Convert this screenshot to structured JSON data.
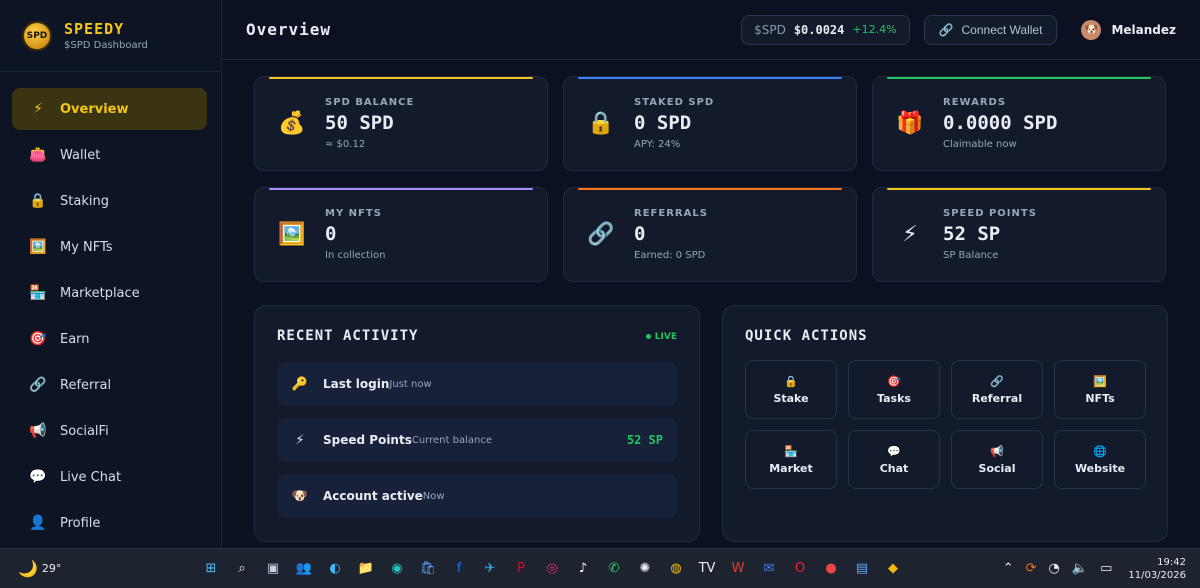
{
  "brand": {
    "logo_text": "SPD",
    "name": "SPEEDY",
    "subtitle": "$SPD Dashboard"
  },
  "sidebar": {
    "items": [
      {
        "label": "Overview",
        "icon": "⚡",
        "active": true
      },
      {
        "label": "Wallet",
        "icon": "👛"
      },
      {
        "label": "Staking",
        "icon": "🔒"
      },
      {
        "label": "My NFTs",
        "icon": "🖼️"
      },
      {
        "label": "Marketplace",
        "icon": "🏪"
      },
      {
        "label": "Earn",
        "icon": "🎯"
      },
      {
        "label": "Referral",
        "icon": "🔗"
      },
      {
        "label": "SocialFi",
        "icon": "📢"
      },
      {
        "label": "Live Chat",
        "icon": "💬"
      },
      {
        "label": "Profile",
        "icon": "👤"
      }
    ]
  },
  "header": {
    "title": "Overview",
    "price_symbol": "$SPD",
    "price_value": "$0.0024",
    "price_change": "+12.4%",
    "connect_wallet_label": "Connect Wallet",
    "connect_wallet_icon": "🔗",
    "user_name": "Melandez",
    "user_avatar_icon": "🐶"
  },
  "cards": [
    {
      "label": "SPD BALANCE",
      "value": "50 SPD",
      "sub": "≈ $0.12",
      "icon": "💰",
      "accent": "#f5c518"
    },
    {
      "label": "STAKED SPD",
      "value": "0 SPD",
      "sub": "APY: 24%",
      "icon": "🔒",
      "accent": "#3b82f6"
    },
    {
      "label": "REWARDS",
      "value": "0.0000 SPD",
      "sub": "Claimable now",
      "icon": "🎁",
      "accent": "#22c55e"
    },
    {
      "label": "MY NFTS",
      "value": "0",
      "sub": "In collection",
      "icon": "🖼️",
      "accent": "#a78bfa"
    },
    {
      "label": "REFERRALS",
      "value": "0",
      "sub": "Earned: 0 SPD",
      "icon": "🔗",
      "accent": "#f97316"
    },
    {
      "label": "SPEED POINTS",
      "value": "52 SP",
      "sub": "SP Balance",
      "icon": "⚡",
      "accent": "#f5c518"
    }
  ],
  "activity": {
    "title": "RECENT ACTIVITY",
    "live_label": "LIVE",
    "items": [
      {
        "title": "Last login",
        "time": "Just now",
        "icon": "🔑",
        "amount": ""
      },
      {
        "title": "Speed Points",
        "time": "Current balance",
        "icon": "⚡",
        "amount": "52 SP"
      },
      {
        "title": "Account active",
        "time": "Now",
        "icon": "🐶",
        "amount": ""
      }
    ]
  },
  "quick_actions": {
    "title": "QUICK ACTIONS",
    "items": [
      {
        "label": "Stake",
        "icon": "🔒"
      },
      {
        "label": "Tasks",
        "icon": "🎯"
      },
      {
        "label": "Referral",
        "icon": "🔗"
      },
      {
        "label": "NFTs",
        "icon": "🖼️"
      },
      {
        "label": "Market",
        "icon": "🏪"
      },
      {
        "label": "Chat",
        "icon": "💬"
      },
      {
        "label": "Social",
        "icon": "📢"
      },
      {
        "label": "Website",
        "icon": "🌐"
      }
    ]
  },
  "taskbar": {
    "weather_temp": "29°",
    "weather_icon": "🌙",
    "apps": [
      {
        "name": "start-icon",
        "glyph": "⊞",
        "color": "#4cc2ff"
      },
      {
        "name": "search-icon",
        "glyph": "⌕",
        "color": "#e8ecf4"
      },
      {
        "name": "task-view-icon",
        "glyph": "▣",
        "color": "#c9d1e0"
      },
      {
        "name": "teams-icon",
        "glyph": "👥",
        "color": "#7b83eb"
      },
      {
        "name": "copilot-icon",
        "glyph": "◐",
        "color": "#38bdf8"
      },
      {
        "name": "file-explorer-icon",
        "glyph": "📁",
        "color": "#f5c518"
      },
      {
        "name": "edge-icon",
        "glyph": "◉",
        "color": "#22c1c3"
      },
      {
        "name": "store-icon",
        "glyph": "🛍",
        "color": "#60a5fa"
      },
      {
        "name": "facebook-icon",
        "glyph": "f",
        "color": "#1877f2"
      },
      {
        "name": "telegram-icon",
        "glyph": "✈",
        "color": "#2aabee"
      },
      {
        "name": "pinterest-icon",
        "glyph": "P",
        "color": "#e60023"
      },
      {
        "name": "instagram-icon",
        "glyph": "◎",
        "color": "#e1306c"
      },
      {
        "name": "tiktok-icon",
        "glyph": "♪",
        "color": "#ffffff"
      },
      {
        "name": "whatsapp-icon",
        "glyph": "✆",
        "color": "#25d366"
      },
      {
        "name": "chatgpt-icon",
        "glyph": "✺",
        "color": "#e8ecf4"
      },
      {
        "name": "chrome-icon",
        "glyph": "◍",
        "color": "#fbbc05"
      },
      {
        "name": "tradingview-icon",
        "glyph": "TV",
        "color": "#e8ecf4"
      },
      {
        "name": "wps-icon",
        "glyph": "W",
        "color": "#e63b2e"
      },
      {
        "name": "mail-icon",
        "glyph": "✉",
        "color": "#3b82f6"
      },
      {
        "name": "opera-icon",
        "glyph": "O",
        "color": "#ff1b2d"
      },
      {
        "name": "app-red-icon",
        "glyph": "●",
        "color": "#ef4444"
      },
      {
        "name": "notes-icon",
        "glyph": "▤",
        "color": "#60a5fa"
      },
      {
        "name": "binance-icon",
        "glyph": "◆",
        "color": "#f0b90b"
      }
    ],
    "time": "19:42",
    "date": "11/03/2026"
  }
}
